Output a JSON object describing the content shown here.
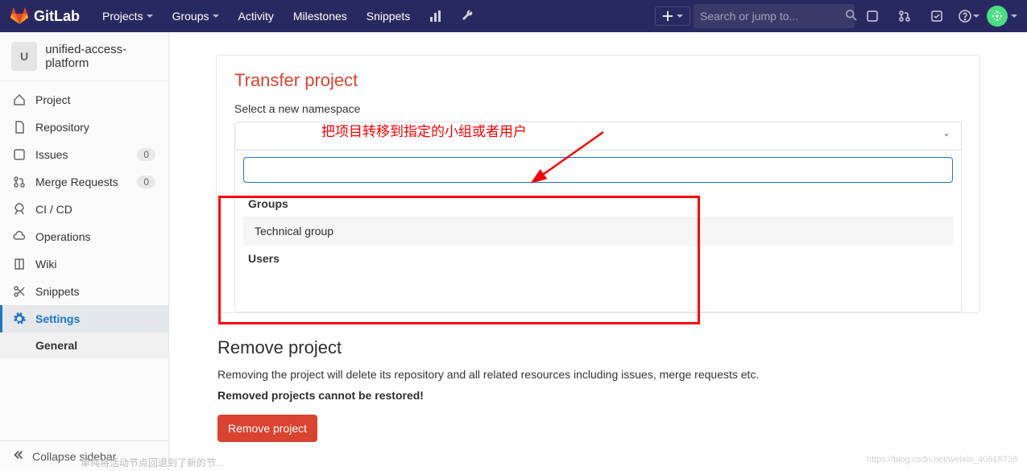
{
  "topbar": {
    "brand": "GitLab",
    "nav": {
      "projects": "Projects",
      "groups": "Groups",
      "activity": "Activity",
      "milestones": "Milestones",
      "snippets": "Snippets"
    },
    "search_placeholder": "Search or jump to..."
  },
  "sidebar": {
    "project_initial": "U",
    "project_name": "unified-access-platform",
    "items": [
      {
        "label": "Project"
      },
      {
        "label": "Repository"
      },
      {
        "label": "Issues",
        "badge": "0"
      },
      {
        "label": "Merge Requests",
        "badge": "0"
      },
      {
        "label": "CI / CD"
      },
      {
        "label": "Operations"
      },
      {
        "label": "Wiki"
      },
      {
        "label": "Snippets"
      },
      {
        "label": "Settings"
      }
    ],
    "sub_item": "General",
    "collapse": "Collapse sidebar"
  },
  "main": {
    "transfer": {
      "title": "Transfer project",
      "label": "Select a new namespace",
      "annotation": "把项目转移到指定的小组或者用户",
      "dropdown": {
        "groups_head": "Groups",
        "option1": "Technical group",
        "users_head": "Users"
      }
    },
    "remove": {
      "title": "Remove project",
      "desc": "Removing the project will delete its repository and all related resources including issues, merge requests etc.",
      "warn": "Removed projects cannot be restored!",
      "button": "Remove project"
    }
  },
  "bottom_text": "单纯将活动节点回退到了新的节..."
}
